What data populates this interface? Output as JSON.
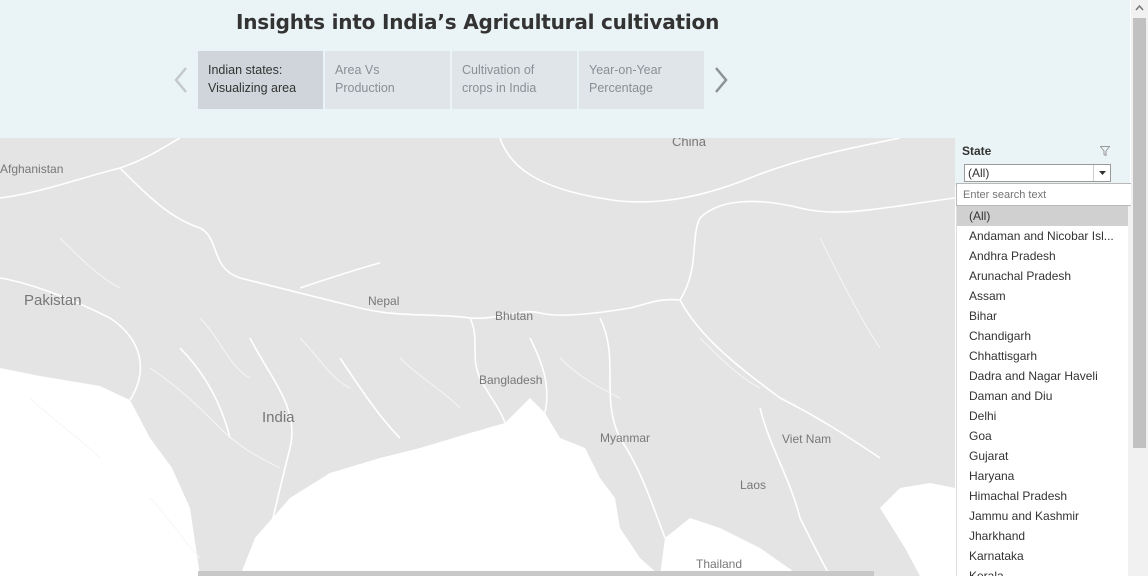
{
  "dashboard": {
    "title": "Insights into India’s Agricultural cultivation"
  },
  "story_points": [
    {
      "line1": "Indian states:",
      "line2": "Visualizing area",
      "active": true
    },
    {
      "line1": "Area Vs",
      "line2": "Production",
      "active": false
    },
    {
      "line1": "Cultivation of",
      "line2": "crops in India",
      "active": false
    },
    {
      "line1": "Year-on-Year",
      "line2": "Percentage",
      "active": false
    }
  ],
  "map": {
    "labels": {
      "afghanistan": "Afghanistan",
      "pakistan": "Pakistan",
      "nepal": "Nepal",
      "bhutan": "Bhutan",
      "bangladesh": "Bangladesh",
      "india": "India",
      "myanmar": "Myanmar",
      "china": "China",
      "vietnam": "Viet Nam",
      "laos": "Laos",
      "thailand": "Thailand"
    }
  },
  "filter": {
    "title": "State",
    "selected": "(All)",
    "search_placeholder": "Enter search text",
    "options": [
      "(All)",
      "Andaman and Nicobar Isl...",
      "Andhra Pradesh",
      "Arunachal Pradesh",
      "Assam",
      "Bihar",
      "Chandigarh",
      "Chhattisgarh",
      "Dadra and Nagar Haveli",
      "Daman and Diu",
      "Delhi",
      "Goa",
      "Gujarat",
      "Haryana",
      "Himachal Pradesh",
      "Jammu and Kashmir",
      "Jharkhand",
      "Karnataka",
      "Kerala"
    ]
  },
  "colors": {
    "header_bg": "#eaf3f5",
    "map_land": "#e4e4e4",
    "map_water": "#ffffff",
    "story_active": "#cfd5da",
    "story_inactive": "#dfe5e9"
  }
}
